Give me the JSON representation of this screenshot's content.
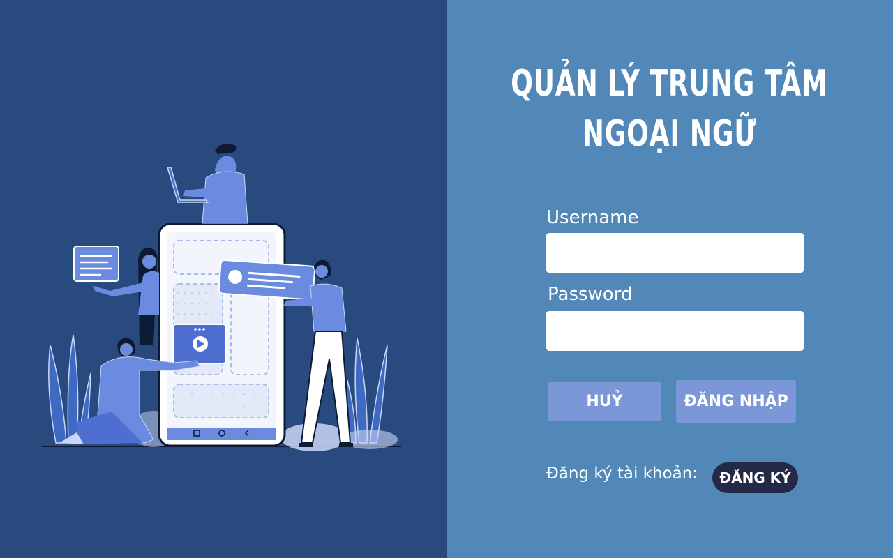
{
  "header": {
    "title_line1": "QUẢN LÝ TRUNG TÂM",
    "title_line2": "NGOẠI NGỮ"
  },
  "form": {
    "username_label": "Username",
    "username_value": "",
    "password_label": "Password",
    "password_value": ""
  },
  "actions": {
    "cancel_label": "HUỶ",
    "login_label": "ĐĂNG NHẬP"
  },
  "register": {
    "prompt": "Đăng ký tài khoản:",
    "button_label": "ĐĂNG KÝ"
  },
  "colors": {
    "left_bg": "#294a7f",
    "right_bg": "#5188b8",
    "button_bg": "#7b97d8",
    "register_button_bg": "#232946"
  }
}
